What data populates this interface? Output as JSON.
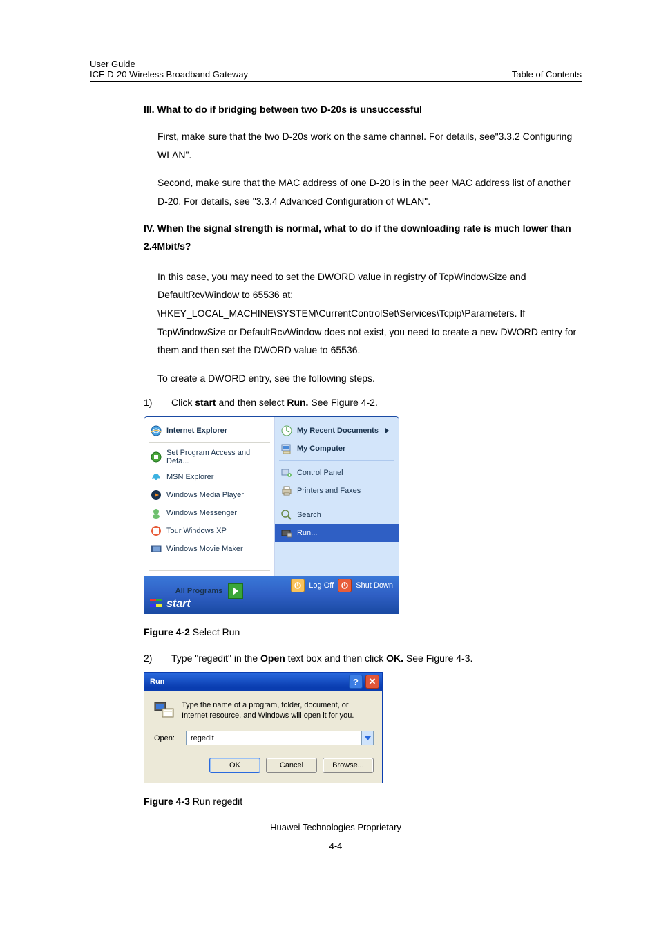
{
  "header": {
    "left1": "User Guide",
    "left2": "ICE D-20 Wireless Broadband Gateway",
    "right": "Table of Contents"
  },
  "section3": {
    "heading": "III. What to do if bridging between two D-20s is unsuccessful",
    "p1": "First, make sure that the two D-20s work on the same channel. For details, see\"3.3.2 Configuring WLAN\".",
    "p2": "Second, make sure that the MAC address of one D-20 is in the peer MAC address list of another D-20. For details, see \"3.3.4  Advanced Configuration of WLAN\"."
  },
  "section4": {
    "heading": "IV. When the signal strength is normal, what to do if the downloading rate is much lower than 2.4Mbit/s?",
    "p1": "In this case, you may need to set the DWORD value in registry of TcpWindowSize and DefaultRcvWindow to 65536 at: \\HKEY_LOCAL_MACHINE\\SYSTEM\\CurrentControlSet\\Services\\Tcpip\\Parameters. If TcpWindowSize or DefaultRcvWindow does not exist, you need to create a new DWORD entry for them and then set the DWORD value to 65536.",
    "p2": "To create a DWORD entry, see the following steps."
  },
  "steps": {
    "s1_num": "1)",
    "s1_pre": "Click ",
    "s1_b1": "start",
    "s1_mid": " and then select ",
    "s1_b2": "Run.",
    "s1_post": " See Figure 4-2.",
    "s2_num": "2)",
    "s2_pre": "Type \"regedit\" in the ",
    "s2_b1": "Open",
    "s2_mid": " text box and then click ",
    "s2_b2": "OK.",
    "s2_post": " See Figure 4-3."
  },
  "fig42": {
    "caption_b": "Figure 4-2 ",
    "caption_t": "Select Run",
    "left": {
      "ie": "Internet Explorer",
      "spad": "Set Program Access and Defa...",
      "msn": "MSN Explorer",
      "wmp": "Windows Media Player",
      "wmsg": "Windows Messenger",
      "tour": "Tour Windows XP",
      "wmm": "Windows Movie Maker",
      "allprogs": "All Programs"
    },
    "right": {
      "recent": "My Recent Documents",
      "mycomp": "My Computer",
      "cpanel": "Control Panel",
      "printers": "Printers and Faxes",
      "search": "Search",
      "run": "Run..."
    },
    "bottom": {
      "logoff": "Log Off",
      "shutdown": "Shut Down"
    },
    "taskbar": {
      "start": "start"
    }
  },
  "fig43": {
    "caption_b": "Figure 4-3 ",
    "caption_t": "Run regedit",
    "title": "Run",
    "desc": "Type the name of a program, folder, document, or Internet resource, and Windows will open it for you.",
    "open_label": "Open:",
    "open_value": "regedit",
    "ok": "OK",
    "cancel": "Cancel",
    "browse": "Browse..."
  },
  "footer": {
    "proprietary": "Huawei Technologies Proprietary",
    "pagenum": "4-4"
  }
}
